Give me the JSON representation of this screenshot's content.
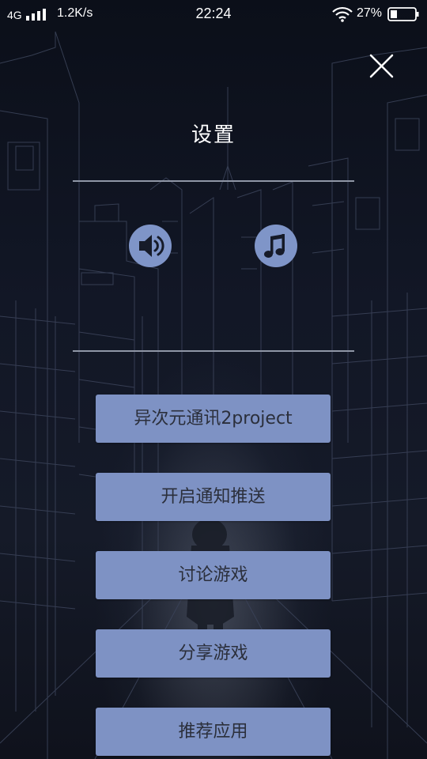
{
  "status_bar": {
    "network": "4G",
    "speed": "1.2K/s",
    "time": "22:24",
    "battery_percent": "27%"
  },
  "settings": {
    "title": "设置",
    "close_icon": "close-icon",
    "sound_icon": "speaker-icon",
    "music_icon": "music-note-icon"
  },
  "menu": {
    "items": [
      "异次元通讯2project",
      "开启通知推送",
      "讨论游戏",
      "分享游戏",
      "推荐应用"
    ]
  },
  "colors": {
    "button": "#7e92c4",
    "button_text": "#2b2f3b",
    "background": "#0d111c"
  }
}
